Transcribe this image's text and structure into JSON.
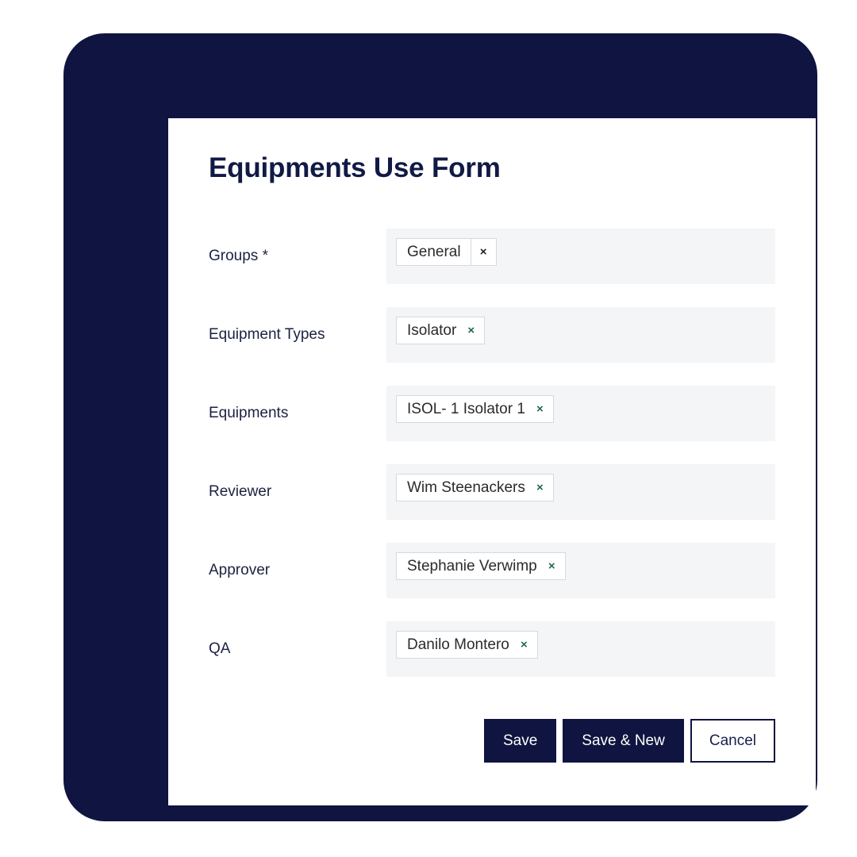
{
  "form": {
    "title": "Equipments Use Form",
    "fields": [
      {
        "label": "Groups *",
        "chip": {
          "text": "General",
          "remove_icon": "close-icon",
          "remove_glyph": "×",
          "style": "divided",
          "remove_color": "#1f1f1f"
        }
      },
      {
        "label": "Equipment Types",
        "chip": {
          "text": "Isolator",
          "remove_icon": "close-icon",
          "remove_glyph": "×",
          "style": "green",
          "remove_color": "#1d6b48"
        }
      },
      {
        "label": "Equipments",
        "chip": {
          "text": "ISOL- 1 Isolator 1",
          "remove_icon": "close-icon",
          "remove_glyph": "×",
          "style": "green",
          "remove_color": "#1d6b48"
        }
      },
      {
        "label": "Reviewer",
        "chip": {
          "text": "Wim Steenackers",
          "remove_icon": "close-icon",
          "remove_glyph": "×",
          "style": "green",
          "remove_color": "#1d6b48"
        }
      },
      {
        "label": "Approver",
        "chip": {
          "text": "Stephanie Verwimp",
          "remove_icon": "close-icon",
          "remove_glyph": "×",
          "style": "green",
          "remove_color": "#1d6b48"
        }
      },
      {
        "label": "QA",
        "chip": {
          "text": "Danilo Montero",
          "remove_icon": "close-icon",
          "remove_glyph": "×",
          "style": "green",
          "remove_color": "#1d6b48"
        }
      }
    ],
    "actions": [
      {
        "label": "Save",
        "variant": "primary"
      },
      {
        "label": "Save & New",
        "variant": "primary"
      },
      {
        "label": "Cancel",
        "variant": "secondary"
      }
    ]
  },
  "theme": {
    "navy": "#0f1440",
    "field_background": "#f4f5f7",
    "chip_border": "#d6d9de",
    "remove_green": "#1d6b48",
    "panel_background": "#ffffff"
  }
}
